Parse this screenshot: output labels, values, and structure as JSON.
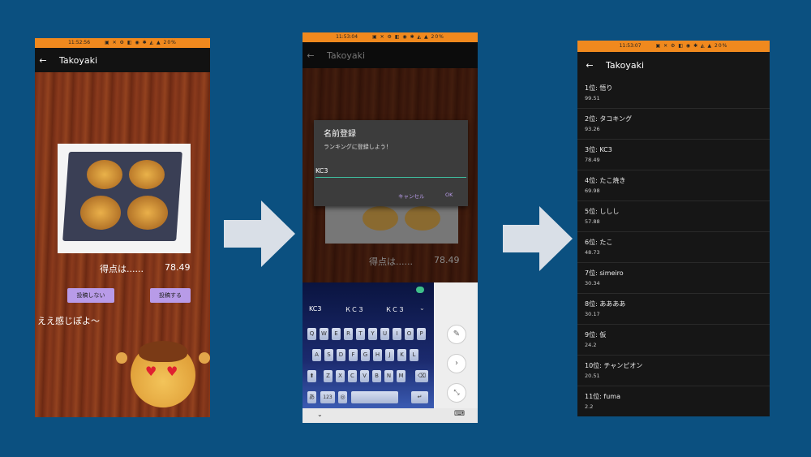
{
  "app_title": "Takoyaki",
  "screen1": {
    "time": "11:52:56",
    "score_label": "得点は......",
    "score_value": "78.49",
    "no_post_button": "投稿しない",
    "post_button": "投稿する",
    "comment": "ええ感じぽよ〜"
  },
  "screen2": {
    "time": "11:53:04",
    "dialog_title": "名前登録",
    "dialog_message": "ランキングに登録しよう！",
    "name_input_value": "KC3",
    "cancel_button": "キャンセル",
    "ok_button": "OK",
    "bg_score_label": "得点は......",
    "bg_score_value": "78.49",
    "suggestions": [
      "KC3",
      "ＫＣ３",
      "ＫＣ３"
    ],
    "keyboard_rows": [
      [
        "Q",
        "W",
        "E",
        "R",
        "T",
        "Y",
        "U",
        "I",
        "O",
        "P"
      ],
      [
        "A",
        "S",
        "D",
        "F",
        "G",
        "H",
        "J",
        "K",
        "L"
      ],
      [
        "Z",
        "X",
        "C",
        "V",
        "B",
        "N",
        "M"
      ]
    ],
    "key_kana": "あ",
    "key_num": "123"
  },
  "screen3": {
    "time": "11:53:07",
    "ranking": [
      {
        "name": "1位: 悟り",
        "score": "99.51"
      },
      {
        "name": "2位: タコキング",
        "score": "93.26"
      },
      {
        "name": "3位: KC3",
        "score": "78.49"
      },
      {
        "name": "4位: たこ焼き",
        "score": "69.98"
      },
      {
        "name": "5位: ししし",
        "score": "57.88"
      },
      {
        "name": "6位: たこ",
        "score": "48.73"
      },
      {
        "name": "7位: simeiro",
        "score": "30.34"
      },
      {
        "name": "8位: ああああ",
        "score": "30.17"
      },
      {
        "name": "9位: 仮",
        "score": "24.2"
      },
      {
        "name": "10位: チャンピオン",
        "score": "20.51"
      },
      {
        "name": "11位: fuma",
        "score": "2.2"
      }
    ]
  },
  "status_battery": "20%",
  "colors": {
    "background": "#0b5080",
    "status_bar": "#f0891e",
    "button": "#b89be8",
    "accent_teal": "#3fbfa0",
    "dialog_action": "#b89be8"
  }
}
